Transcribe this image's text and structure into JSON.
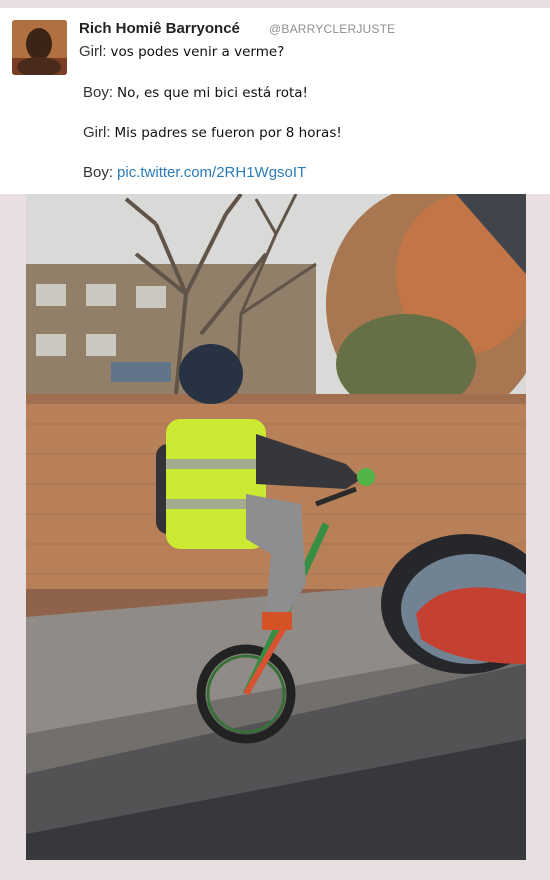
{
  "tweet": {
    "author_name": "Rich Homiê Barryoncé",
    "author_handle": "@BARRYCLERJUSTE",
    "lines": [
      {
        "speaker": "Girl:",
        "text": "vos podes venir a verme?"
      },
      {
        "speaker": "Boy:",
        "text": "No, es que mi bici está rota!"
      },
      {
        "speaker": "Girl:",
        "text": "Mis padres se fueron por 8 horas!"
      },
      {
        "speaker": "Boy:",
        "text": ""
      }
    ],
    "link_text": "pic.twitter.com/2RH1WgsoIT"
  },
  "photo": {
    "icon": "photo-of-boy-riding-wheelie"
  },
  "colors": {
    "background": "#e9dfe1",
    "card": "#ffffff",
    "link": "#2b7bb9",
    "handle": "#8f8f8f"
  }
}
